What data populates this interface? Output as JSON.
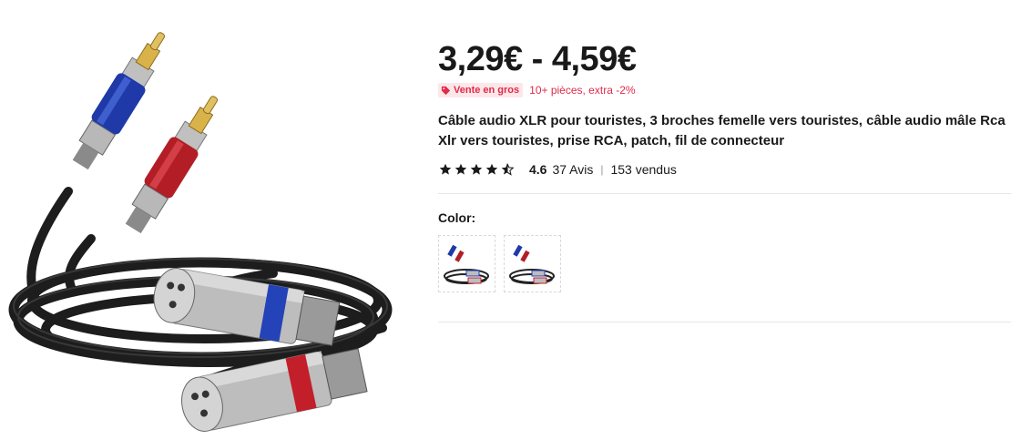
{
  "product": {
    "image_alt": "xlr-to-rca-cable-photo",
    "price_range": "3,29€ - 4,59€",
    "bulk_badge": "Vente en gros",
    "bulk_note": "10+ pièces, extra -2%",
    "title": "Câble audio XLR pour touristes, 3 broches femelle vers touristes, câble audio mâle Rca Xlr vers touristes, prise RCA, patch, fil de connecteur",
    "rating_value": "4.6",
    "reviews": "37 Avis",
    "separator": "|",
    "sold": "153 vendus",
    "color_label": "Color:",
    "color_options": [
      "color-option-1",
      "color-option-2"
    ],
    "star_rating": 4.5
  },
  "colors": {
    "accent_red": "#e02a4a",
    "badge_bg": "#fde7e9",
    "text": "#191919",
    "divider": "#e6e6e6"
  }
}
